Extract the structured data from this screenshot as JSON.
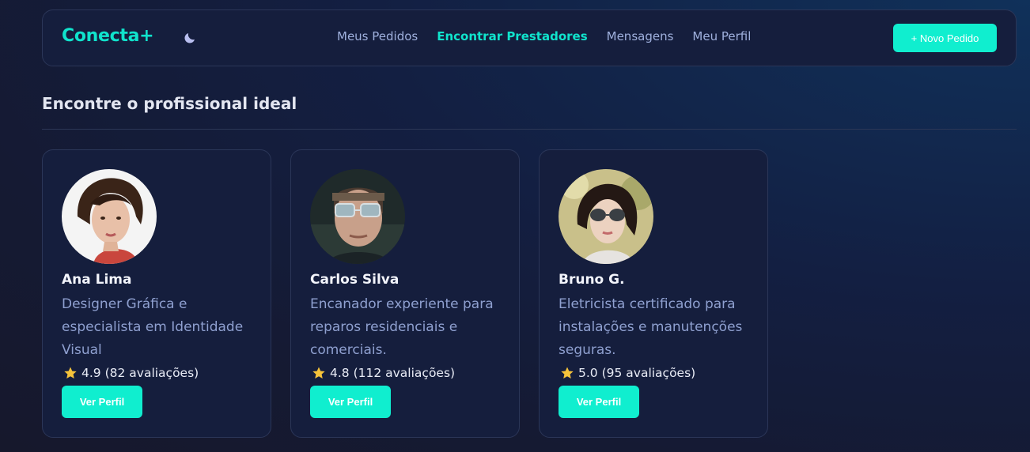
{
  "header": {
    "logo": "Conecta+",
    "theme_icon": "moon-icon",
    "nav": [
      {
        "label": "Meus Pedidos",
        "active": false
      },
      {
        "label": "Encontrar Prestadores",
        "active": true
      },
      {
        "label": "Mensagens",
        "active": false
      },
      {
        "label": "Meu Perfil",
        "active": false
      }
    ],
    "new_order_label": "+ Novo Pedido"
  },
  "main": {
    "title": "Encontre o profissional ideal",
    "providers": [
      {
        "name": "Ana Lima",
        "description": "Designer Gráfica e especialista em Identidade Visual",
        "rating": "4.9 (82 avaliações)",
        "button": "Ver Perfil"
      },
      {
        "name": "Carlos Silva",
        "description": "Encanador experiente para reparos residenciais e comerciais.",
        "rating": "4.8 (112 avaliações)",
        "button": "Ver Perfil"
      },
      {
        "name": "Bruno G.",
        "description": "Eletricista certificado para instalações e manutenções seguras.",
        "rating": "5.0 (95 avaliações)",
        "button": "Ver Perfil"
      }
    ]
  },
  "colors": {
    "accent": "#10eecf",
    "background": "#151a33",
    "card": "#151e3d",
    "nav_text": "#9fb0dd",
    "star": "#f5c33b"
  }
}
